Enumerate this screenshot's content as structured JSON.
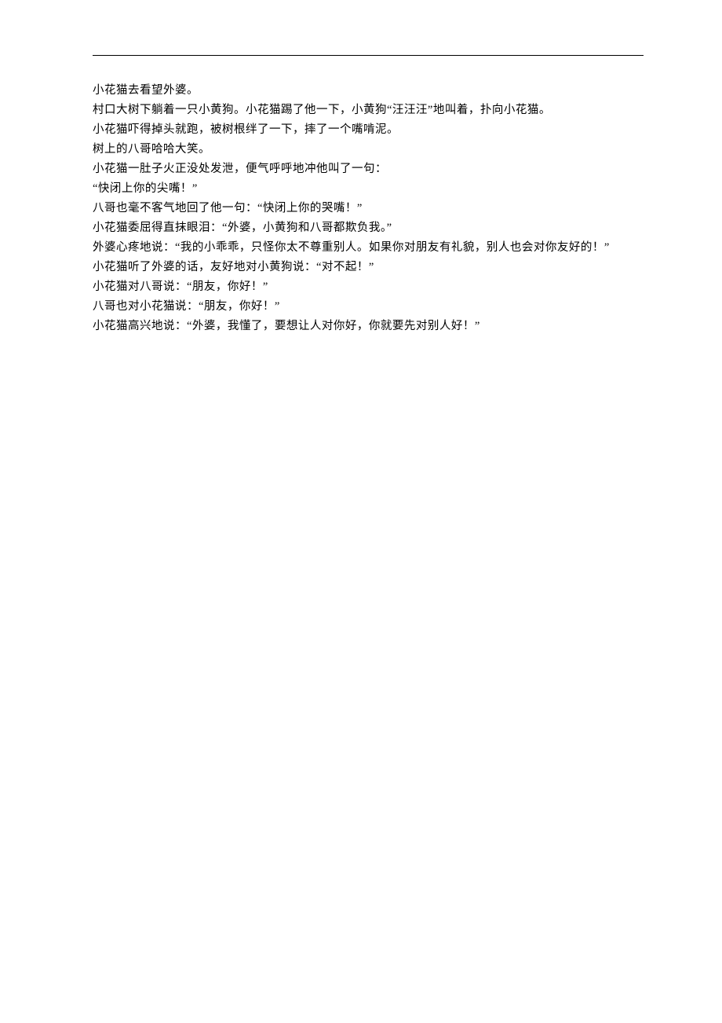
{
  "paragraphs": [
    "小花猫去看望外婆。",
    "村口大树下躺着一只小黄狗。小花猫踢了他一下，小黄狗“汪汪汪”地叫着，扑向小花猫。",
    "小花猫吓得掉头就跑，被树根绊了一下，摔了一个嘴啃泥。",
    "树上的八哥哈哈大笑。",
    "小花猫一肚子火正没处发泄，便气呼呼地冲他叫了一句：",
    "“快闭上你的尖嘴！”",
    "八哥也毫不客气地回了他一句：“快闭上你的哭嘴！”",
    "小花猫委屈得直抹眼泪：“外婆，小黄狗和八哥都欺负我。”",
    "外婆心疼地说：“我的小乖乖，只怪你太不尊重别人。如果你对朋友有礼貌，别人也会对你友好的！”",
    "小花猫听了外婆的话，友好地对小黄狗说：“对不起！”",
    "小花猫对八哥说：“朋友，你好！”",
    "八哥也对小花猫说：“朋友，你好！”",
    "小花猫高兴地说：“外婆，我懂了，要想让人对你好，你就要先对别人好！”"
  ]
}
